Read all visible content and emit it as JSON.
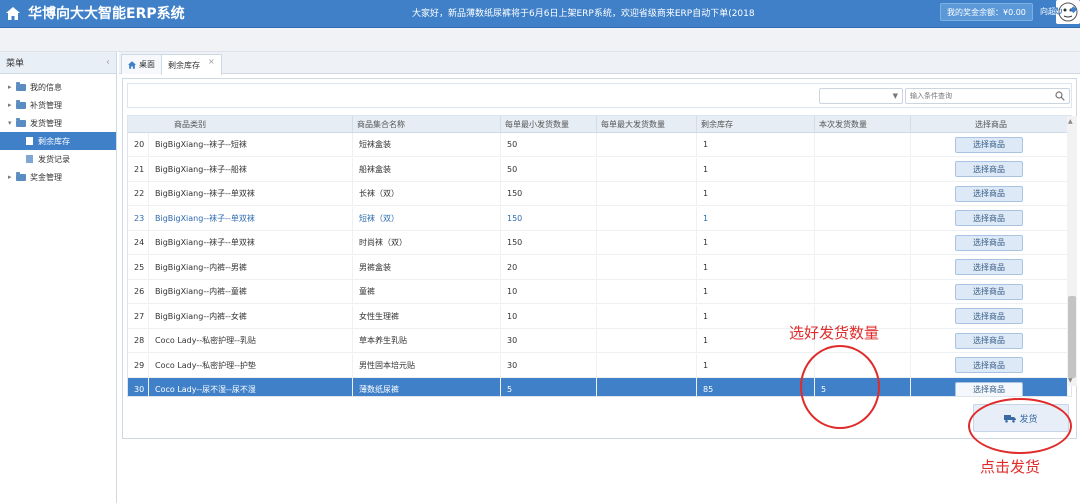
{
  "header": {
    "title": "华博向大大智能ERP系统",
    "notice": "大家好，新品薄数纸尿裤将于6月6日上架ERP系统，欢迎省级商来ERP自动下单(2018",
    "balance": "我的奖金余额：¥0.00",
    "user": "向超"
  },
  "sidebar": {
    "title": "菜单",
    "items": [
      {
        "label": "我的信息"
      },
      {
        "label": "补货管理"
      },
      {
        "label": "发货管理",
        "children": [
          {
            "label": "剩余库存"
          },
          {
            "label": "发货记录"
          }
        ]
      },
      {
        "label": "奖金管理"
      }
    ]
  },
  "tabs": [
    {
      "label": "桌面"
    },
    {
      "label": "剩余库存"
    }
  ],
  "search": {
    "placeholder": "输入条件查询"
  },
  "table": {
    "headers": [
      "商品类别",
      "商品集合名称",
      "每单最小发货数量",
      "每单最大发货数量",
      "剩余库存",
      "本次发货数量",
      "选择商品"
    ],
    "rows": [
      {
        "no": "20",
        "category": "BigBigXiang--袜子--短袜",
        "name": "短袜盒装",
        "min": "50",
        "max": "",
        "stock": "1",
        "qty": "",
        "action": "选择商品"
      },
      {
        "no": "21",
        "category": "BigBigXiang--袜子--船袜",
        "name": "船袜盒装",
        "min": "50",
        "max": "",
        "stock": "1",
        "qty": "",
        "action": "选择商品"
      },
      {
        "no": "22",
        "category": "BigBigXiang--袜子--单双袜",
        "name": "长袜（双）",
        "min": "150",
        "max": "",
        "stock": "1",
        "qty": "",
        "action": "选择商品"
      },
      {
        "no": "23",
        "category": "BigBigXiang--袜子--单双袜",
        "name": "短袜（双）",
        "min": "150",
        "max": "",
        "stock": "1",
        "qty": "",
        "action": "选择商品"
      },
      {
        "no": "24",
        "category": "BigBigXiang--袜子--单双袜",
        "name": "时尚袜（双）",
        "min": "150",
        "max": "",
        "stock": "1",
        "qty": "",
        "action": "选择商品"
      },
      {
        "no": "25",
        "category": "BigBigXiang--内裤--男裤",
        "name": "男裤盒装",
        "min": "20",
        "max": "",
        "stock": "1",
        "qty": "",
        "action": "选择商品"
      },
      {
        "no": "26",
        "category": "BigBigXiang--内裤--童裤",
        "name": "童裤",
        "min": "10",
        "max": "",
        "stock": "1",
        "qty": "",
        "action": "选择商品"
      },
      {
        "no": "27",
        "category": "BigBigXiang--内裤--女裤",
        "name": "女性生理裤",
        "min": "10",
        "max": "",
        "stock": "1",
        "qty": "",
        "action": "选择商品"
      },
      {
        "no": "28",
        "category": "Coco Lady--私密护理--乳贴",
        "name": "草本养生乳贴",
        "min": "30",
        "max": "",
        "stock": "1",
        "qty": "",
        "action": "选择商品"
      },
      {
        "no": "29",
        "category": "Coco Lady--私密护理--护垫",
        "name": "男性固本培元贴",
        "min": "30",
        "max": "",
        "stock": "1",
        "qty": "",
        "action": "选择商品"
      },
      {
        "no": "30",
        "category": "Coco Lady--尿不湿--尿不湿",
        "name": "薄数纸尿裤",
        "min": "5",
        "max": "",
        "stock": "85",
        "qty": "5",
        "action": "选择商品"
      }
    ]
  },
  "ship_button": "发货",
  "annotations": {
    "select_qty": "选好发货数量",
    "click_ship": "点击发货"
  },
  "colors": {
    "header_bg": "#3f80c9",
    "selected_row": "#3f80c9",
    "annotation": "#e02b2b"
  }
}
